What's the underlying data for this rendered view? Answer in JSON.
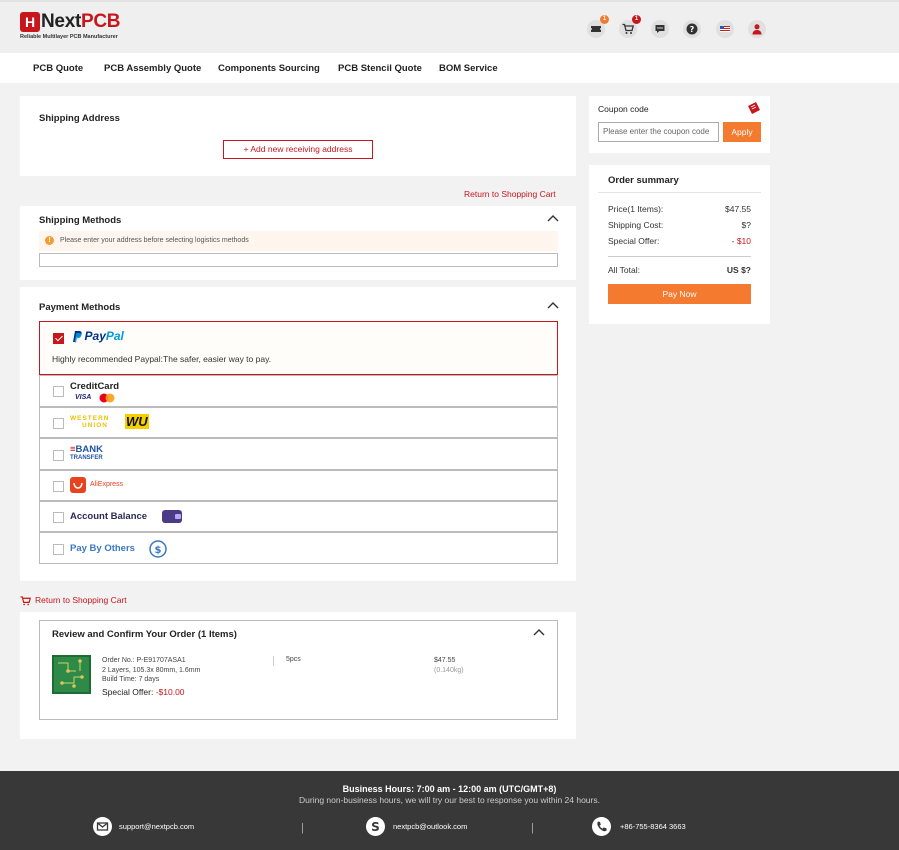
{
  "brand": {
    "logo_letter": "H",
    "name_next": "Next",
    "name_pcb": "PCB",
    "tagline": "Reliable Multilayer PCB Manufacturer",
    "primary_color": "#c8161d",
    "accent_color": "#f47a30"
  },
  "header": {
    "coupon_badge": "1",
    "cart_badge": "1"
  },
  "nav": [
    "PCB Quote",
    "PCB Assembly Quote",
    "Components Sourcing",
    "PCB Stencil Quote",
    "BOM Service"
  ],
  "shipping_address": {
    "title": "Shipping Address",
    "add_button": "+ Add new receiving address"
  },
  "return_link": "Return to Shopping Cart",
  "shipping_methods": {
    "title": "Shipping Methods",
    "notice": "Please enter your address before selecting logistics methods"
  },
  "payment": {
    "title": "Payment Methods",
    "paypal_pay": "Pay",
    "paypal_pal": "Pal",
    "paypal_desc": "Highly recommended Paypal:The safer, easier way to pay.",
    "credit_card": "CreditCard",
    "visa": "VISA",
    "western_top": "WESTERN",
    "western_bottom": "UNION",
    "wu": "WU",
    "bank_top": "BANK",
    "bank_bottom": "TRANSFER",
    "aliexpress": "AliExpress",
    "account_balance": "Account Balance",
    "pay_by_others": "Pay By Others"
  },
  "review": {
    "title": "Review and Confirm Your Order (1 Items)",
    "order_no": "Order No.: P-E91707ASA1",
    "spec": "2 Layers, 105.3x 80mm, 1.6mm",
    "build_time": "Build Time: 7 days",
    "special_label": "Special Offer: ",
    "special_value": "-$10.00",
    "qty": "5pcs",
    "price": "$47.55",
    "weight": "(0.140kg)"
  },
  "coupon": {
    "label": "Coupon code",
    "placeholder": "Please enter the coupon code",
    "apply": "Apply"
  },
  "summary": {
    "title": "Order summary",
    "price_label": "Price(1 Items):",
    "price_value": "$47.55",
    "shipping_label": "Shipping Cost:",
    "shipping_value": "$?",
    "offer_label": "Special Offer:",
    "offer_value": "- $10",
    "total_label": "All Total:",
    "total_value": "US $?",
    "pay_now": "Pay Now"
  },
  "footer": {
    "hours": "Business Hours: 7:00 am - 12:00 am (UTC/GMT+8)",
    "note": "During non-business hours, we will try our best to response you within 24 hours.",
    "email": "support@nextpcb.com",
    "skype": "nextpcb@outlook.com",
    "phone": "+86-755-8364 3663"
  }
}
